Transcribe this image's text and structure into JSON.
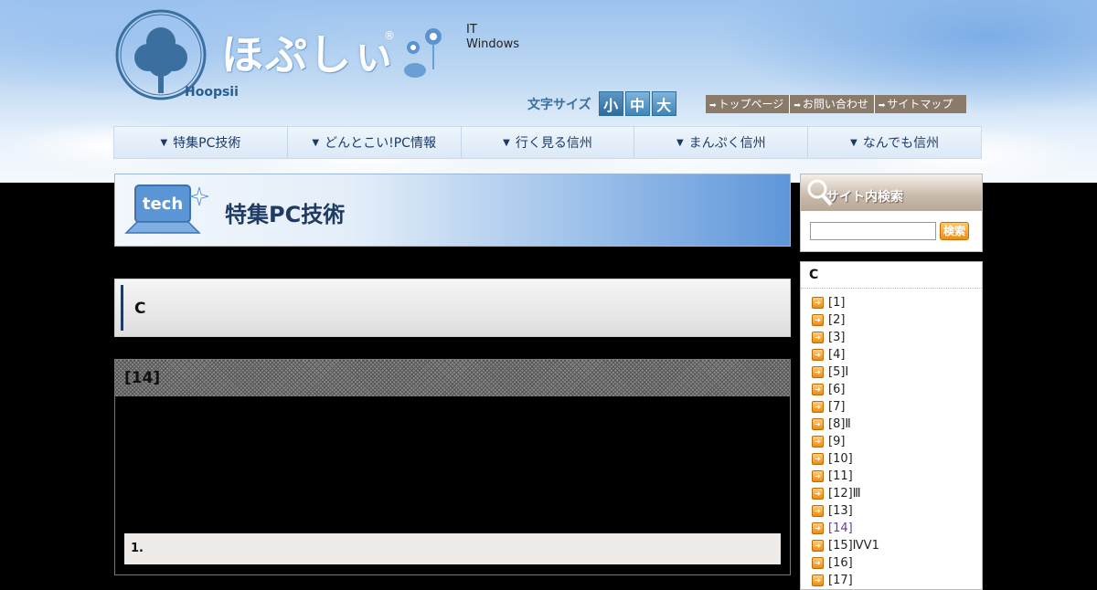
{
  "site": {
    "logo_text": "ほぷしぃ",
    "logo_reg": "®",
    "logo_sub": "Hoopsii",
    "tagline": [
      "IT",
      "Windows"
    ]
  },
  "fontsize": {
    "label": "文字サイズ",
    "options": [
      "小",
      "中",
      "大"
    ],
    "selected": "小"
  },
  "utility_links": [
    "トップページ",
    "お問い合わせ",
    "サイトマップ"
  ],
  "nav": [
    "特集PC技術",
    "どんとこい!PC情報",
    "行く見る信州",
    "まんぷく信州",
    "なんでも信州"
  ],
  "section_header": {
    "title": "特集PC技術",
    "icon_label": "tech"
  },
  "post": {
    "title": "C",
    "box_heading": "[14]",
    "point": "1."
  },
  "search": {
    "title": "サイト内検索",
    "input_value": "",
    "button_label": "検索"
  },
  "sidebar": {
    "title": "C",
    "items": [
      {
        "label": "[1]"
      },
      {
        "label": "[2]"
      },
      {
        "label": "[3]"
      },
      {
        "label": "[4]"
      },
      {
        "label": "[5]Ⅰ"
      },
      {
        "label": "[6]"
      },
      {
        "label": "[7]"
      },
      {
        "label": "[8]Ⅱ"
      },
      {
        "label": "[9]"
      },
      {
        "label": "[10]"
      },
      {
        "label": "[11]"
      },
      {
        "label": "[12]Ⅲ"
      },
      {
        "label": "[13]"
      },
      {
        "label": "[14]",
        "visited": true
      },
      {
        "label": "[15]ⅣV1"
      },
      {
        "label": "[16]"
      },
      {
        "label": "[17]"
      }
    ]
  },
  "colors": {
    "nav_text": "#1d3a66",
    "visited_link": "#6b3aa0",
    "util_bg": "#8a7a6a"
  }
}
